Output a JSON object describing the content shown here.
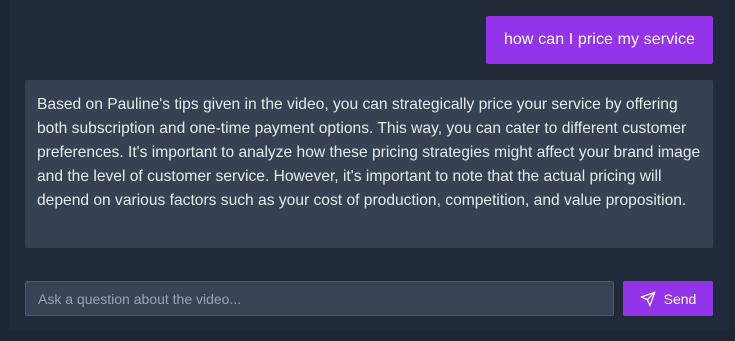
{
  "conversation": {
    "user_message": "how can I price my service",
    "assistant_message": "Based on Pauline's tips given in the video, you can strategically price your service by offering both subscription and one-time payment options. This way, you can cater to different customer preferences. It's important to analyze how these pricing strategies might affect your brand image and the level of customer service. However, it's important to note that the actual pricing will depend on various factors such as your cost of production, competition, and value proposition."
  },
  "composer": {
    "placeholder": "Ask a question about the video...",
    "value": "",
    "send_label": "Send",
    "send_icon": "send-icon"
  },
  "colors": {
    "accent": "#9333ea",
    "background": "#1d2633",
    "panel": "#202a38",
    "assistant_bubble": "#364152",
    "input_background": "#384455"
  }
}
